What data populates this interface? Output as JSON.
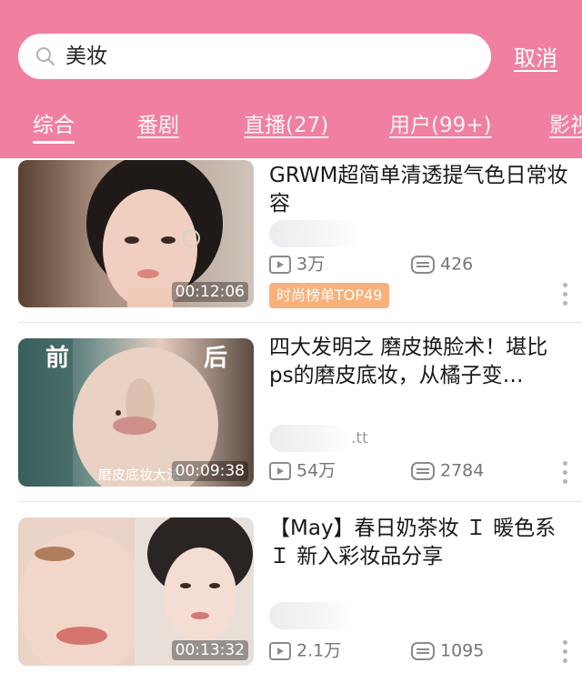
{
  "search": {
    "query": "美妆",
    "cancel_label": "取消"
  },
  "tabs": [
    {
      "label": "综合"
    },
    {
      "label": "番剧"
    },
    {
      "label": "直播(27)"
    },
    {
      "label": "用户(99+)"
    },
    {
      "label": "影视"
    }
  ],
  "results": [
    {
      "title": "GRWM超简单清透提气色日常妆容",
      "duration": "00:12:06",
      "plays": "3万",
      "comments": "426",
      "badge": "时尚榜单TOP49"
    },
    {
      "title": "四大发明之 磨皮换脸术！堪比ps的磨皮底妆，从橘子变…",
      "duration": "00:09:38",
      "plays": "54万",
      "comments": "2784",
      "author_suffix": ".tt",
      "thumb_overlay": {
        "left": "前",
        "right": "后",
        "caption": "磨皮底妆大法"
      }
    },
    {
      "title": "【May】春日奶茶妆 Ｉ 暖色系 Ｉ 新入彩妆品分享",
      "duration": "00:13:32",
      "plays": "2.1万",
      "comments": "1095"
    }
  ],
  "colors": {
    "header": "#f07fa0",
    "badge": "#f9b17b",
    "stat_text": "#757575"
  },
  "icons": {
    "search": "search-icon",
    "play": "play-count-icon",
    "comment": "comment-icon",
    "more": "more-icon"
  }
}
